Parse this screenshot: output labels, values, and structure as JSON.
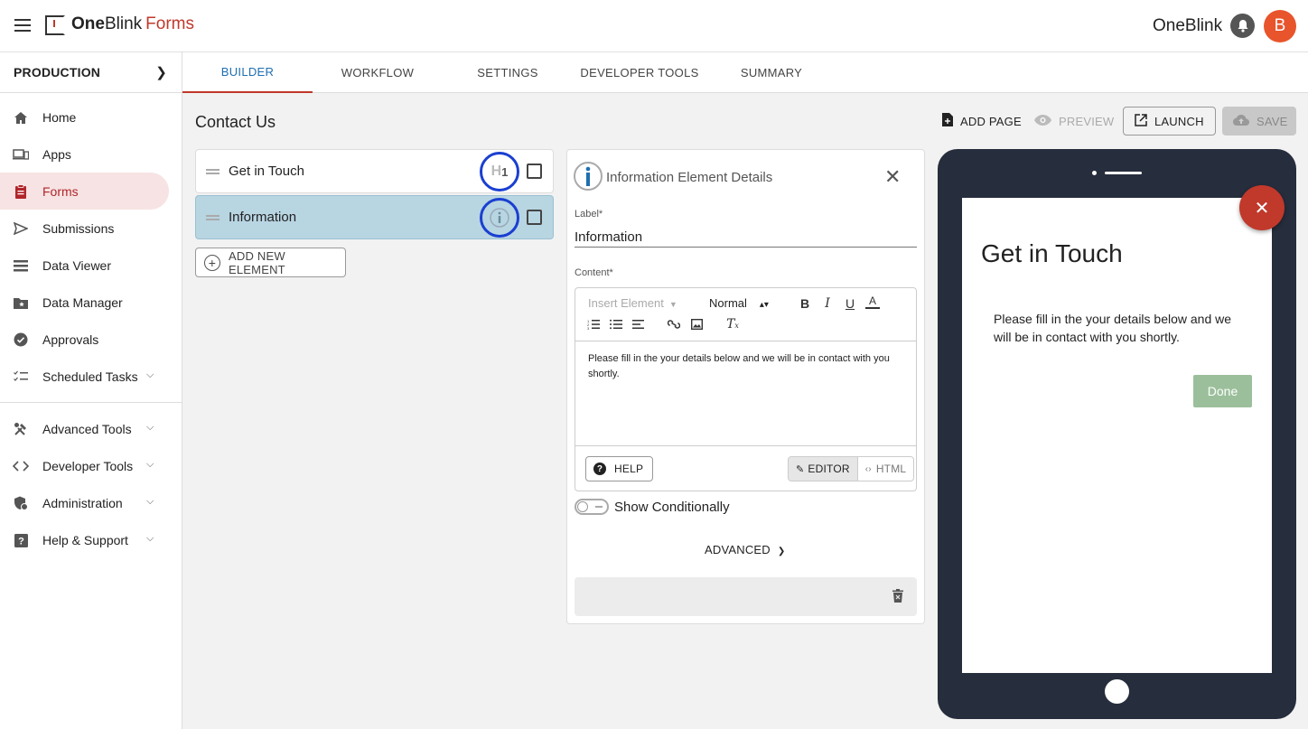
{
  "header": {
    "logo_bold": "One",
    "logo_regular": "Blink",
    "logo_product": "Forms",
    "org_name": "OneBlink",
    "avatar_initial": "B",
    "brand_color": "#c0392b"
  },
  "sidebar": {
    "environment": "PRODUCTION",
    "items": [
      {
        "label": "Home",
        "icon": "home-icon"
      },
      {
        "label": "Apps",
        "icon": "devices-icon"
      },
      {
        "label": "Forms",
        "icon": "clipboard-icon",
        "active": true
      },
      {
        "label": "Submissions",
        "icon": "send-icon"
      },
      {
        "label": "Data Viewer",
        "icon": "list-icon"
      },
      {
        "label": "Data Manager",
        "icon": "folder-star-icon"
      },
      {
        "label": "Approvals",
        "icon": "check-circle-icon"
      },
      {
        "label": "Scheduled Tasks",
        "icon": "checklist-icon",
        "expandable": true
      },
      {
        "label": "Advanced Tools",
        "icon": "tools-icon",
        "expandable": true
      },
      {
        "label": "Developer Tools",
        "icon": "code-icon",
        "expandable": true
      },
      {
        "label": "Administration",
        "icon": "admin-shield-icon",
        "expandable": true
      },
      {
        "label": "Help & Support",
        "icon": "help-icon",
        "expandable": true
      }
    ]
  },
  "tabs": [
    {
      "label": "BUILDER",
      "active": true
    },
    {
      "label": "WORKFLOW"
    },
    {
      "label": "SETTINGS"
    },
    {
      "label": "DEVELOPER TOOLS"
    },
    {
      "label": "SUMMARY"
    }
  ],
  "page": {
    "title": "Contact Us",
    "actions": {
      "add_page": "ADD PAGE",
      "preview": "PREVIEW",
      "launch": "LAUNCH",
      "save": "SAVE"
    }
  },
  "elements": [
    {
      "label": "Get in Touch",
      "type_icon": "heading-h1-icon",
      "type_text": "H1"
    },
    {
      "label": "Information",
      "type_icon": "info-icon",
      "type_text": "i",
      "selected": true
    }
  ],
  "add_element_label": "ADD NEW ELEMENT",
  "details": {
    "title": "Information Element Details",
    "label_field_label": "Label*",
    "label_value": "Information",
    "content_field_label": "Content*",
    "insert_element_placeholder": "Insert Element",
    "format_value": "Normal",
    "content_text": "Please fill in the your details below and we will be in contact with you shortly.",
    "help_label": "HELP",
    "editor_label": "EDITOR",
    "html_label": "HTML",
    "show_conditionally_label": "Show Conditionally",
    "advanced_label": "ADVANCED"
  },
  "preview": {
    "title": "Get in Touch",
    "text": "Please fill in the your details below and we will be in contact with you shortly.",
    "done_label": "Done"
  }
}
